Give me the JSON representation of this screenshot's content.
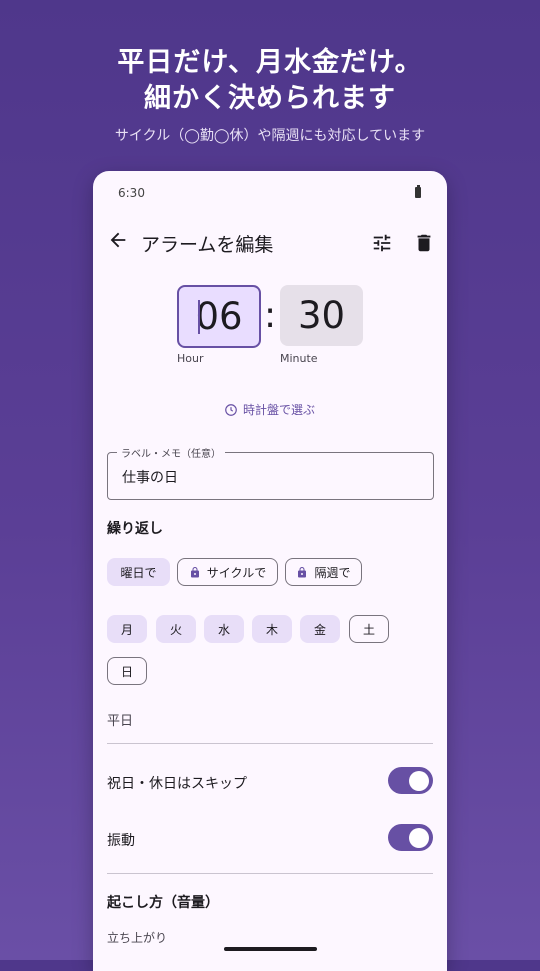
{
  "promo": {
    "headline_line1": "平日だけ、月水金だけ。",
    "headline_line2": "細かく決められます",
    "subline": "サイクル（◯勤◯休）や隔週にも対応しています"
  },
  "status_bar": {
    "time": "6:30"
  },
  "app_bar": {
    "title": "アラームを編集",
    "icons": [
      "back-arrow-icon",
      "tune-icon",
      "delete-icon"
    ]
  },
  "time_picker": {
    "hour": "06",
    "minute": "30",
    "separator": ":",
    "hour_label": "Hour",
    "minute_label": "Minute",
    "clock_button": "時計盤で選ぶ"
  },
  "label_field": {
    "label": "ラベル・メモ（任意）",
    "value": "仕事の日"
  },
  "repeat": {
    "heading": "繰り返し",
    "modes": [
      {
        "label": "曜日で",
        "selected": true,
        "locked": false
      },
      {
        "label": "サイクルで",
        "selected": false,
        "locked": true
      },
      {
        "label": "隔週で",
        "selected": false,
        "locked": true
      }
    ],
    "days": [
      {
        "label": "月",
        "selected": true
      },
      {
        "label": "火",
        "selected": true
      },
      {
        "label": "水",
        "selected": true
      },
      {
        "label": "木",
        "selected": true
      },
      {
        "label": "金",
        "selected": true
      },
      {
        "label": "土",
        "selected": false
      },
      {
        "label": "日",
        "selected": false
      }
    ],
    "summary": "平日"
  },
  "settings": {
    "holiday_skip": {
      "label": "祝日・休日はスキップ",
      "on": true
    },
    "vibration": {
      "label": "振動",
      "on": true
    }
  },
  "wake_section": {
    "heading": "起こし方（音量）",
    "partial_text": "立ち上がり"
  },
  "colors": {
    "accent": "#6750a4",
    "chip_selected": "#e8def8",
    "background_top": "#4f378b"
  }
}
